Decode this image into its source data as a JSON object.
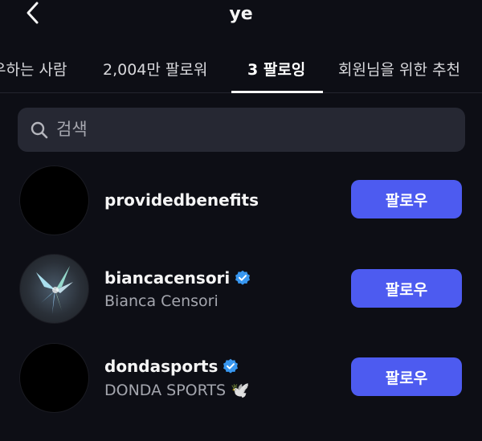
{
  "header": {
    "title": "ye",
    "back_icon": "chevron-left-icon"
  },
  "tabs": [
    {
      "label": "우하는 사람",
      "active": false
    },
    {
      "label": "2,004만 팔로워",
      "active": false
    },
    {
      "label": "3 팔로잉",
      "active": true
    },
    {
      "label": "회원님을 위한 추천",
      "active": false
    }
  ],
  "search": {
    "placeholder": "검색",
    "value": "",
    "icon": "search-icon"
  },
  "accounts": [
    {
      "username": "providedbenefits",
      "full_name": "",
      "verified": false,
      "follow_label": "팔로우"
    },
    {
      "username": "biancacensori",
      "full_name": "Bianca Censori",
      "verified": true,
      "follow_label": "팔로우"
    },
    {
      "username": "dondasports",
      "full_name": "DONDA SPORTS 🕊️",
      "verified": true,
      "follow_label": "팔로우"
    }
  ],
  "colors": {
    "background": "#0d0e15",
    "follow_button": "#4d5bf0",
    "verified_badge": "#3897f0",
    "search_bg": "#262833"
  }
}
